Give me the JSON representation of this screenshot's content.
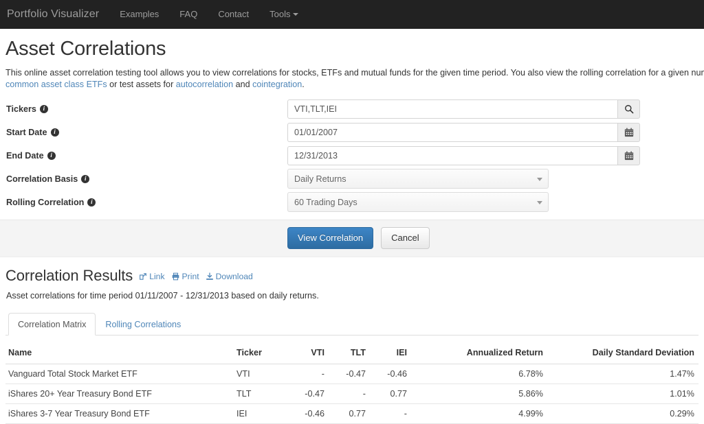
{
  "navbar": {
    "brand": "Portfolio Visualizer",
    "links": [
      {
        "label": "Examples"
      },
      {
        "label": "FAQ"
      },
      {
        "label": "Contact"
      },
      {
        "label": "Tools",
        "caret": true
      }
    ]
  },
  "page": {
    "title": "Asset Correlations",
    "intro": {
      "part1": "This online asset correlation testing tool allows you to view correlations for stocks, ETFs and mutual funds for the given time period. You also view the rolling correlation for a given number of",
      "link1": "correlation matrix for common asset class ETFs",
      "mid1": " or test assets for ",
      "link2": "autocorrelation",
      "mid2": " and ",
      "link3": "cointegration",
      "end": "."
    }
  },
  "form": {
    "tickers": {
      "label": "Tickers",
      "value": "VTI,TLT,IEI",
      "placeholder": "",
      "addon_icon": "search-icon"
    },
    "start_date": {
      "label": "Start Date",
      "value": "01/01/2007",
      "placeholder": "",
      "addon_icon": "calendar-icon"
    },
    "end_date": {
      "label": "End Date",
      "value": "12/31/2013",
      "placeholder": "",
      "addon_icon": "calendar-icon"
    },
    "correlation_basis": {
      "label": "Correlation Basis",
      "value": "Daily Returns"
    },
    "rolling_correlation": {
      "label": "Rolling Correlation",
      "value": "60 Trading Days"
    },
    "submit_label": "View Correlation",
    "cancel_label": "Cancel"
  },
  "results": {
    "title": "Correlation Results",
    "tools": [
      {
        "label": "Link",
        "icon": "external-link-icon"
      },
      {
        "label": "Print",
        "icon": "printer-icon"
      },
      {
        "label": "Download",
        "icon": "download-icon"
      }
    ],
    "subtitle": "Asset correlations for time period 01/11/2007 - 12/31/2013 based on daily returns.",
    "tabs": [
      {
        "label": "Correlation Matrix",
        "active": true
      },
      {
        "label": "Rolling Correlations",
        "active": false
      }
    ]
  },
  "table": {
    "headers": [
      "Name",
      "Ticker",
      "VTI",
      "TLT",
      "IEI",
      "Annualized Return",
      "Daily Standard Deviation"
    ],
    "rows": [
      {
        "name": "Vanguard Total Stock Market ETF",
        "ticker": "VTI",
        "vti": "-",
        "tlt": "-0.47",
        "iei": "-0.46",
        "annualized_return": "6.78%",
        "daily_std_dev": "1.47%"
      },
      {
        "name": "iShares 20+ Year Treasury Bond ETF",
        "ticker": "TLT",
        "vti": "-0.47",
        "tlt": "-",
        "iei": "0.77",
        "annualized_return": "5.86%",
        "daily_std_dev": "1.01%"
      },
      {
        "name": "iShares 3-7 Year Treasury Bond ETF",
        "ticker": "IEI",
        "vti": "-0.46",
        "tlt": "0.77",
        "iei": "-",
        "annualized_return": "4.99%",
        "daily_std_dev": "0.29%"
      }
    ]
  },
  "colors": {
    "navbar_bg": "#222222",
    "link": "#4f86b8",
    "primary_button": "#2d6ca2",
    "band_bg": "#f4f4f4"
  }
}
